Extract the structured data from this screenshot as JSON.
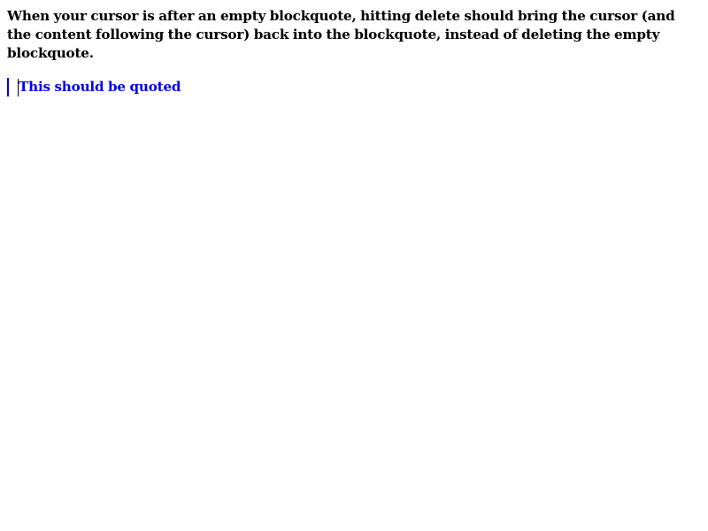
{
  "instructions": {
    "text": "When your cursor is after an empty blockquote, hitting delete should bring the cursor (and the content following the cursor) back into the blockquote, instead of deleting the empty blockquote."
  },
  "editor": {
    "blockquote_text": "This should be quoted"
  },
  "colors": {
    "quote_text": "#0000ee",
    "quote_border": "#0000ee",
    "caret": "#000000",
    "body_text": "#000000",
    "background": "#ffffff"
  }
}
